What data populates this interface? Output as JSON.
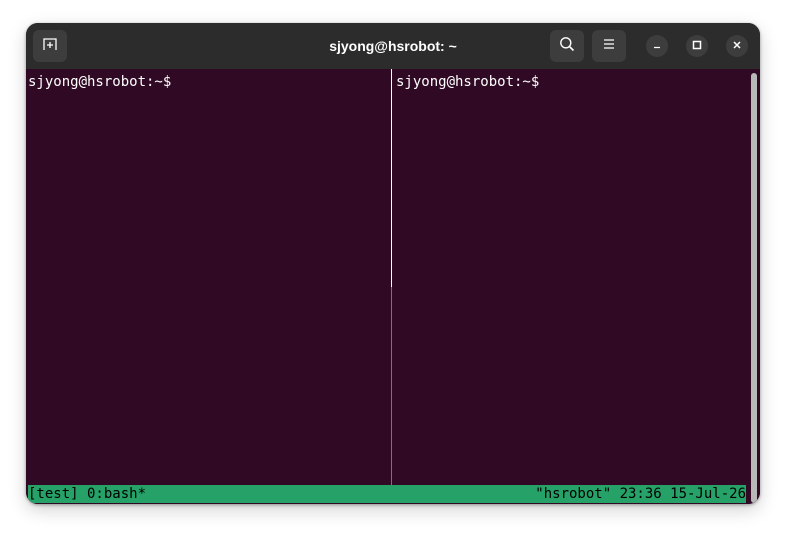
{
  "window": {
    "title": "sjyong@hsrobot: ~"
  },
  "titlebar": {
    "new_tab_icon": "new-tab-icon",
    "search_icon": "search-icon",
    "menu_icon": "hamburger-menu-icon",
    "minimize_icon": "minimize-icon",
    "maximize_icon": "maximize-icon",
    "close_icon": "close-icon"
  },
  "panes": {
    "left": {
      "prompt": "sjyong@hsrobot:~$"
    },
    "right": {
      "prompt": "sjyong@hsrobot:~$"
    }
  },
  "tmux_status": {
    "left": "[test] 0:bash*",
    "right": "\"hsrobot\" 23:36 15-Jul-26"
  },
  "colors": {
    "terminal_bg": "#300a24",
    "titlebar_bg": "#2c2c2c",
    "status_bg": "#26a269",
    "active_border": "#26a269"
  }
}
